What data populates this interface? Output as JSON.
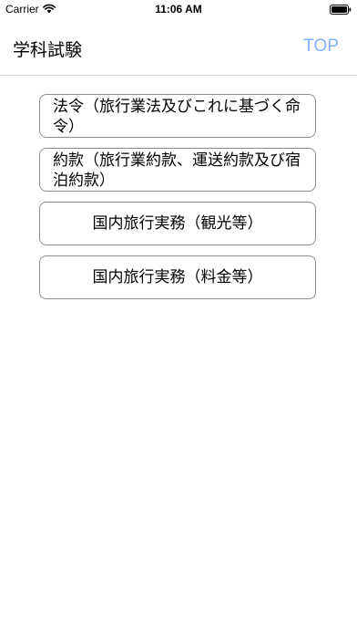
{
  "status_bar": {
    "carrier": "Carrier",
    "time": "11:06 AM",
    "wifi_icon": "wifi-icon",
    "battery_icon": "battery-icon"
  },
  "nav": {
    "title": "学科試験",
    "top_button": "TOP",
    "accent_color": "#7fb3ff"
  },
  "menu": {
    "items": [
      {
        "label": "法令（旅行業法及びこれに基づく命令）"
      },
      {
        "label": "約款（旅行業約款、運送約款及び宿泊約款）"
      },
      {
        "label": "国内旅行実務（観光等）"
      },
      {
        "label": "国内旅行実務（料金等）"
      }
    ]
  }
}
